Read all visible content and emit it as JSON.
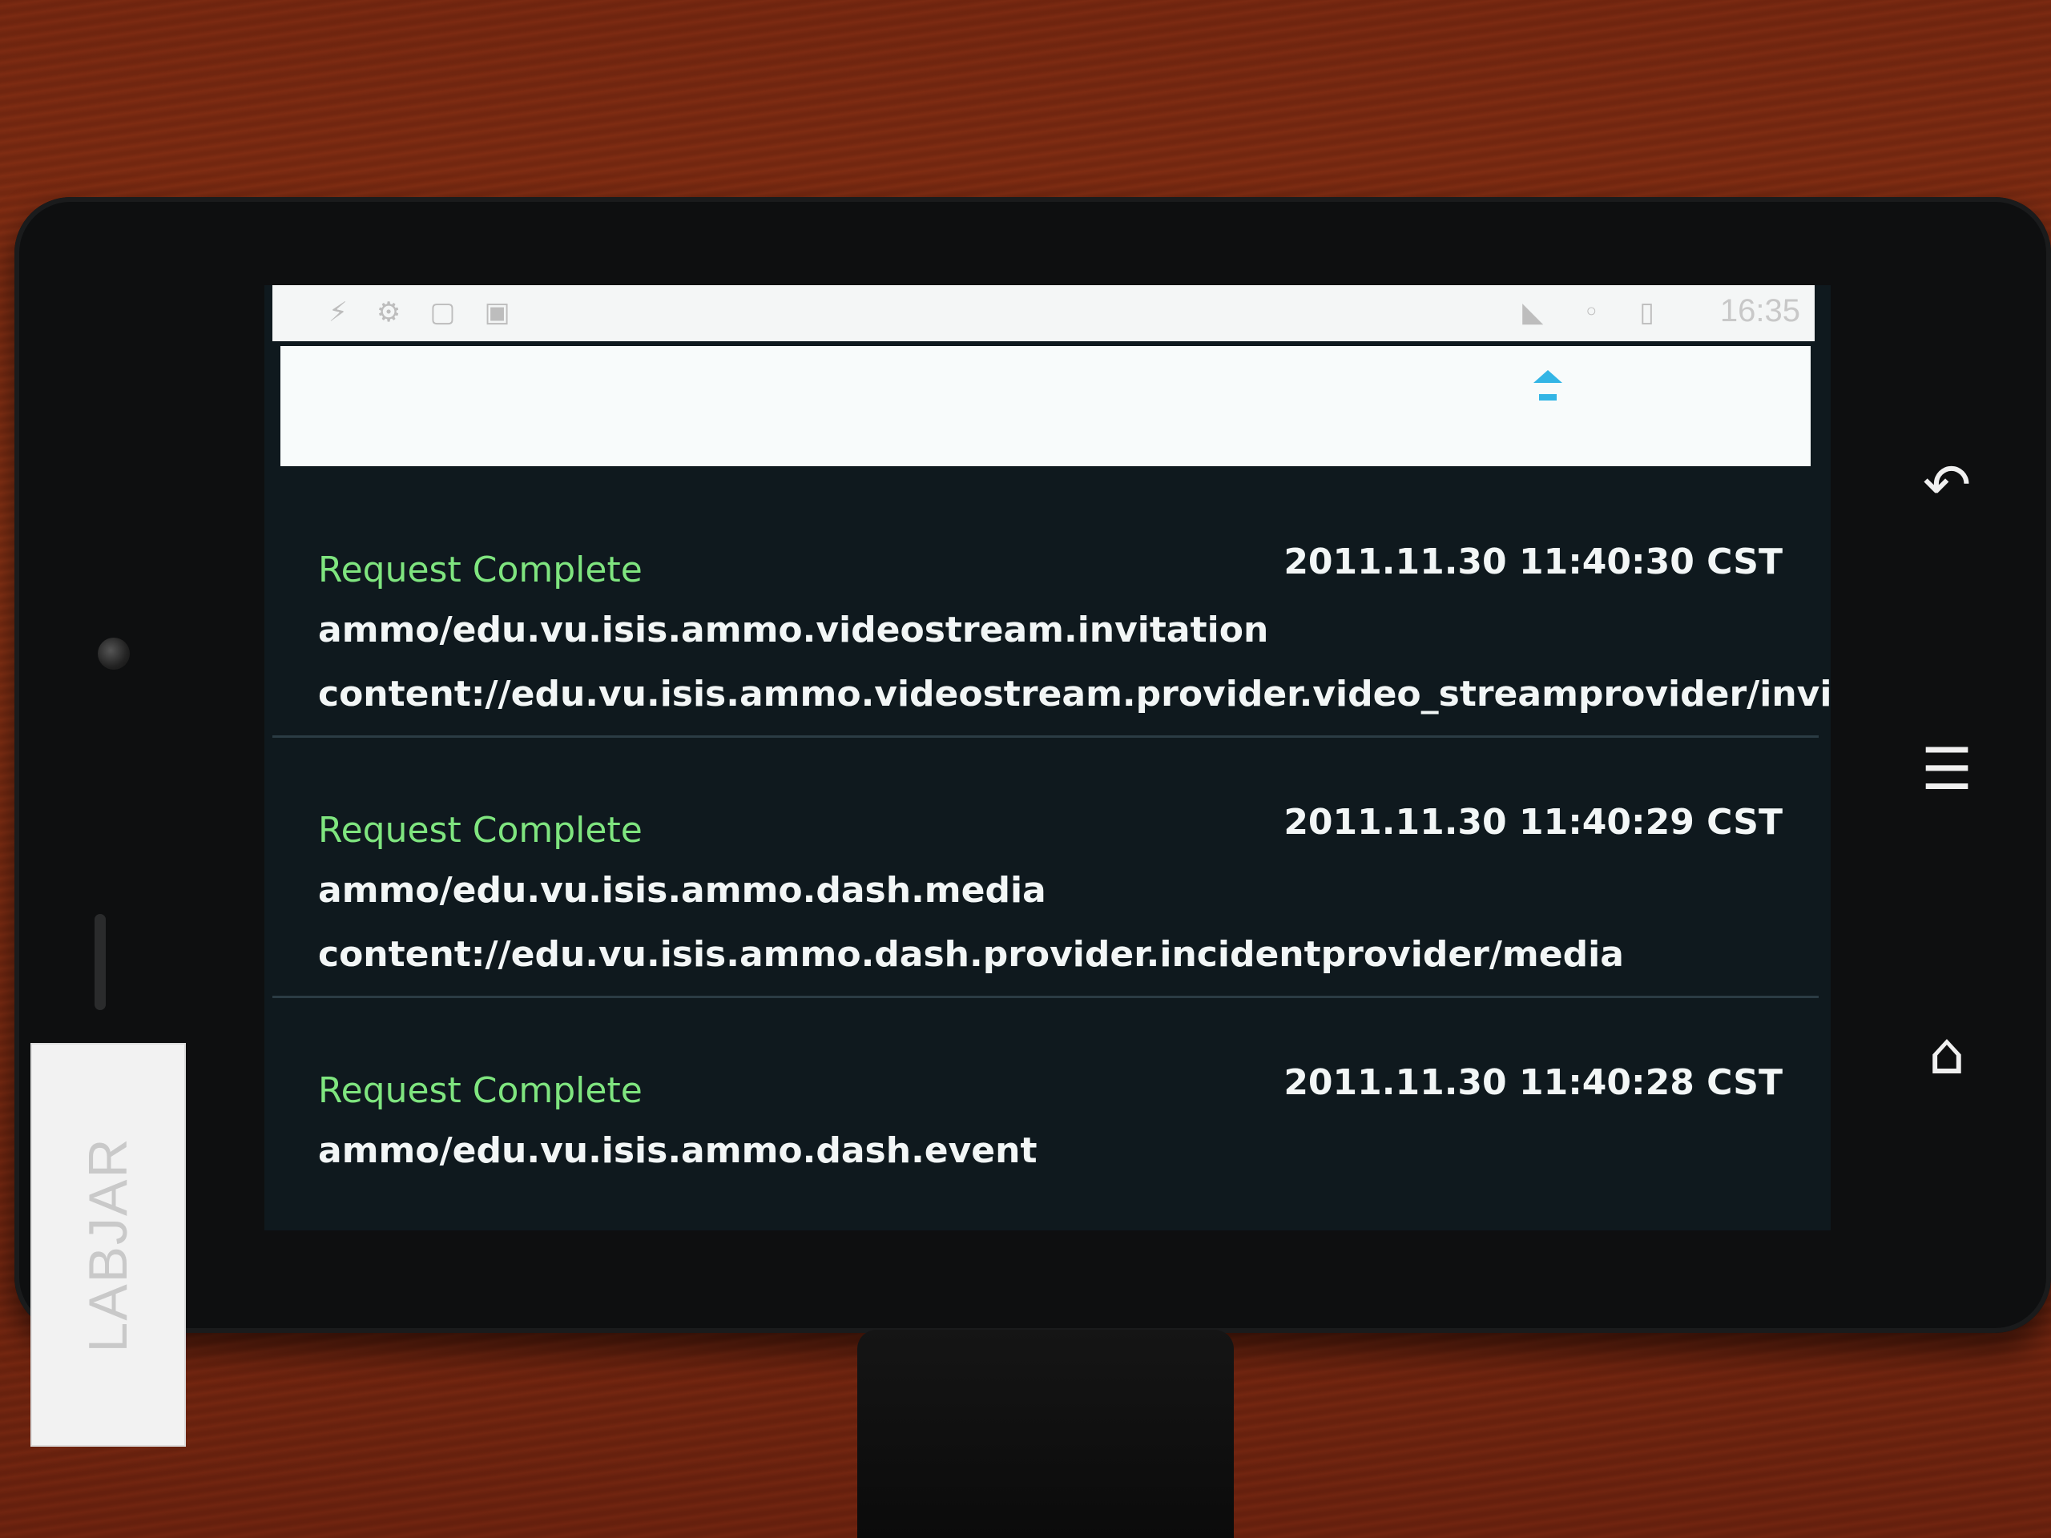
{
  "device": {
    "sticker_text": "LABJAR"
  },
  "statusbar": {
    "time": "16:35",
    "left_icons": [
      "usb-icon",
      "settings-icon",
      "sd-card-icon",
      "notification-icon"
    ],
    "right_icons": [
      "signal-icon",
      "wifi-icon",
      "battery-icon"
    ]
  },
  "titlebar": {
    "sort_icon": "sort-arrows-icon"
  },
  "requests": [
    {
      "status": "Request Complete",
      "timestamp": "2011.11.30 11:40:30 CST",
      "mime": "ammo/edu.vu.isis.ammo.videostream.invitation",
      "uri": "content://edu.vu.isis.ammo.videostream.provider.video_streamprovider/invitation"
    },
    {
      "status": "Request Complete",
      "timestamp": "2011.11.30 11:40:29 CST",
      "mime": "ammo/edu.vu.isis.ammo.dash.media",
      "uri": "content://edu.vu.isis.ammo.dash.provider.incidentprovider/media"
    },
    {
      "status": "Request Complete",
      "timestamp": "2011.11.30 11:40:28 CST",
      "mime": "ammo/edu.vu.isis.ammo.dash.event",
      "uri": ""
    }
  ],
  "navigation": {
    "back": "back-icon",
    "menu": "menu-icon",
    "home": "home-icon"
  }
}
